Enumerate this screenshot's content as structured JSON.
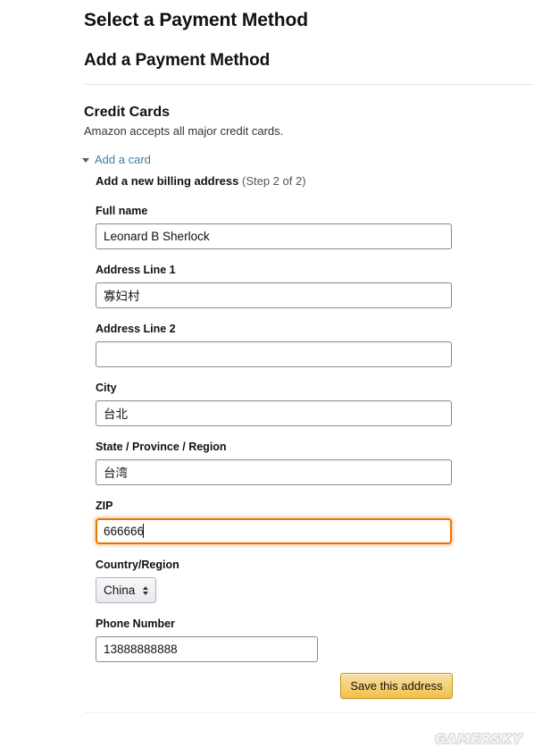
{
  "page": {
    "title_select": "Select a Payment Method",
    "title_add": "Add a Payment Method"
  },
  "credit_cards": {
    "heading": "Credit Cards",
    "subtext": "Amazon accepts all major credit cards.",
    "add_card_link": "Add a card",
    "billing_heading": "Add a new billing address",
    "billing_step": "(Step 2 of 2)"
  },
  "form": {
    "full_name": {
      "label": "Full name",
      "value": "Leonard B Sherlock",
      "placeholder": ""
    },
    "address_line_1": {
      "label": "Address Line 1",
      "value": "寡妇村",
      "placeholder": ""
    },
    "address_line_2": {
      "label": "Address Line 2",
      "value": "",
      "placeholder": ""
    },
    "city": {
      "label": "City",
      "value": "台北",
      "placeholder": ""
    },
    "state": {
      "label": "State / Province / Region",
      "value": "台湾",
      "placeholder": ""
    },
    "zip": {
      "label": "ZIP",
      "value": "666666",
      "placeholder": "",
      "focused": true
    },
    "country": {
      "label": "Country/Region",
      "value": "China",
      "options": [
        "China"
      ]
    },
    "phone": {
      "label": "Phone Number",
      "value": "13888888888",
      "placeholder": ""
    },
    "save_button": "Save this address"
  },
  "watermark": {
    "text": "GAMERSKY"
  },
  "colors": {
    "link": "#3b7fa5",
    "focus_ring": "#e77600",
    "button_gold_top": "#f7dfa5",
    "button_gold_bottom": "#f0c14b",
    "input_border": "#8a8a8a",
    "divider": "#e7e7e7"
  }
}
